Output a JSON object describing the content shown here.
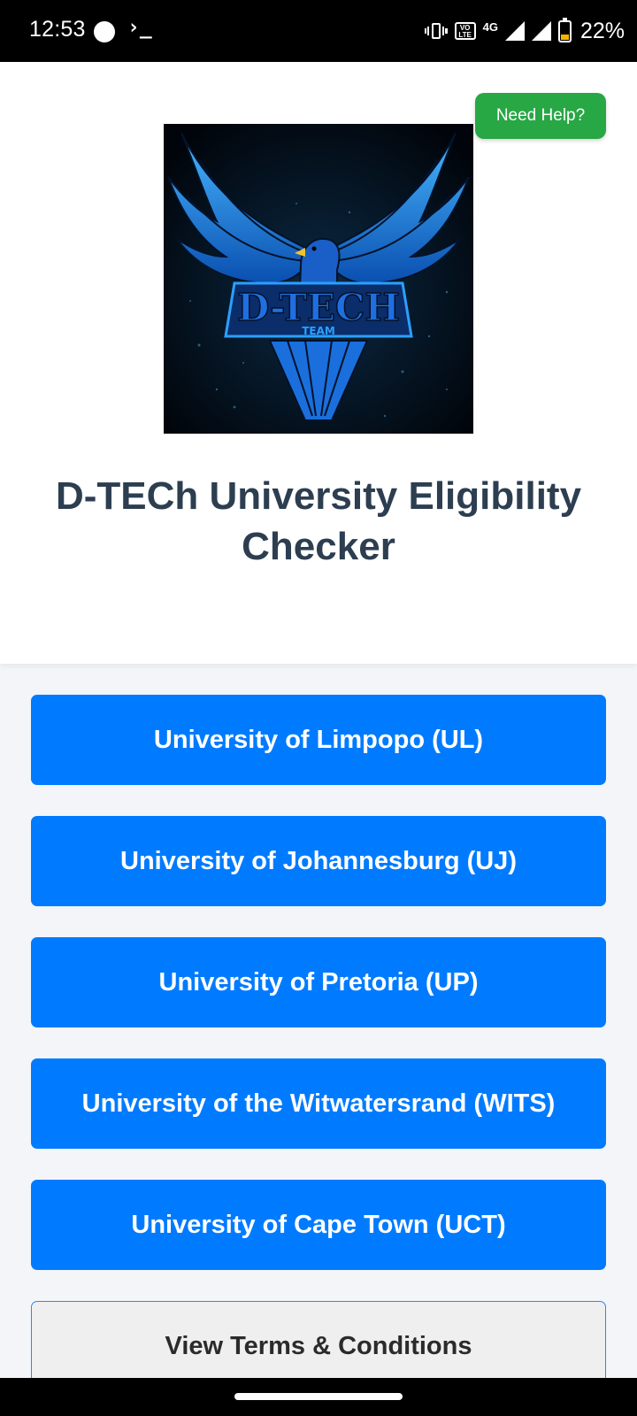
{
  "status_bar": {
    "time": "12:53",
    "terminal_glyph": "›_",
    "network_type": "4G",
    "volte_top": "VO",
    "volte_bottom": "LTE",
    "battery_percent": "22%",
    "battery_level": 0.22,
    "icons": [
      "circle-icon",
      "terminal-icon",
      "vibrate-icon",
      "volte-icon",
      "signal-icon",
      "signal-icon",
      "battery-icon"
    ]
  },
  "header": {
    "help_button_label": "Need Help?",
    "logo": {
      "brand_text": "D-TECH",
      "sub_text": "TEAM"
    },
    "title": "D-TECh University Eligibility Checker"
  },
  "universities": [
    {
      "label": "University of Limpopo (UL)"
    },
    {
      "label": "University of Johannesburg (UJ)"
    },
    {
      "label": "University of Pretoria (UP)"
    },
    {
      "label": "University of the Witwatersrand (WITS)"
    },
    {
      "label": "University of Cape Town (UCT)"
    }
  ],
  "terms_button_label": "View Terms & Conditions",
  "colors": {
    "primary": "#007bff",
    "help": "#28a745",
    "title": "#2c3e50",
    "background": "#f3f5f8"
  }
}
